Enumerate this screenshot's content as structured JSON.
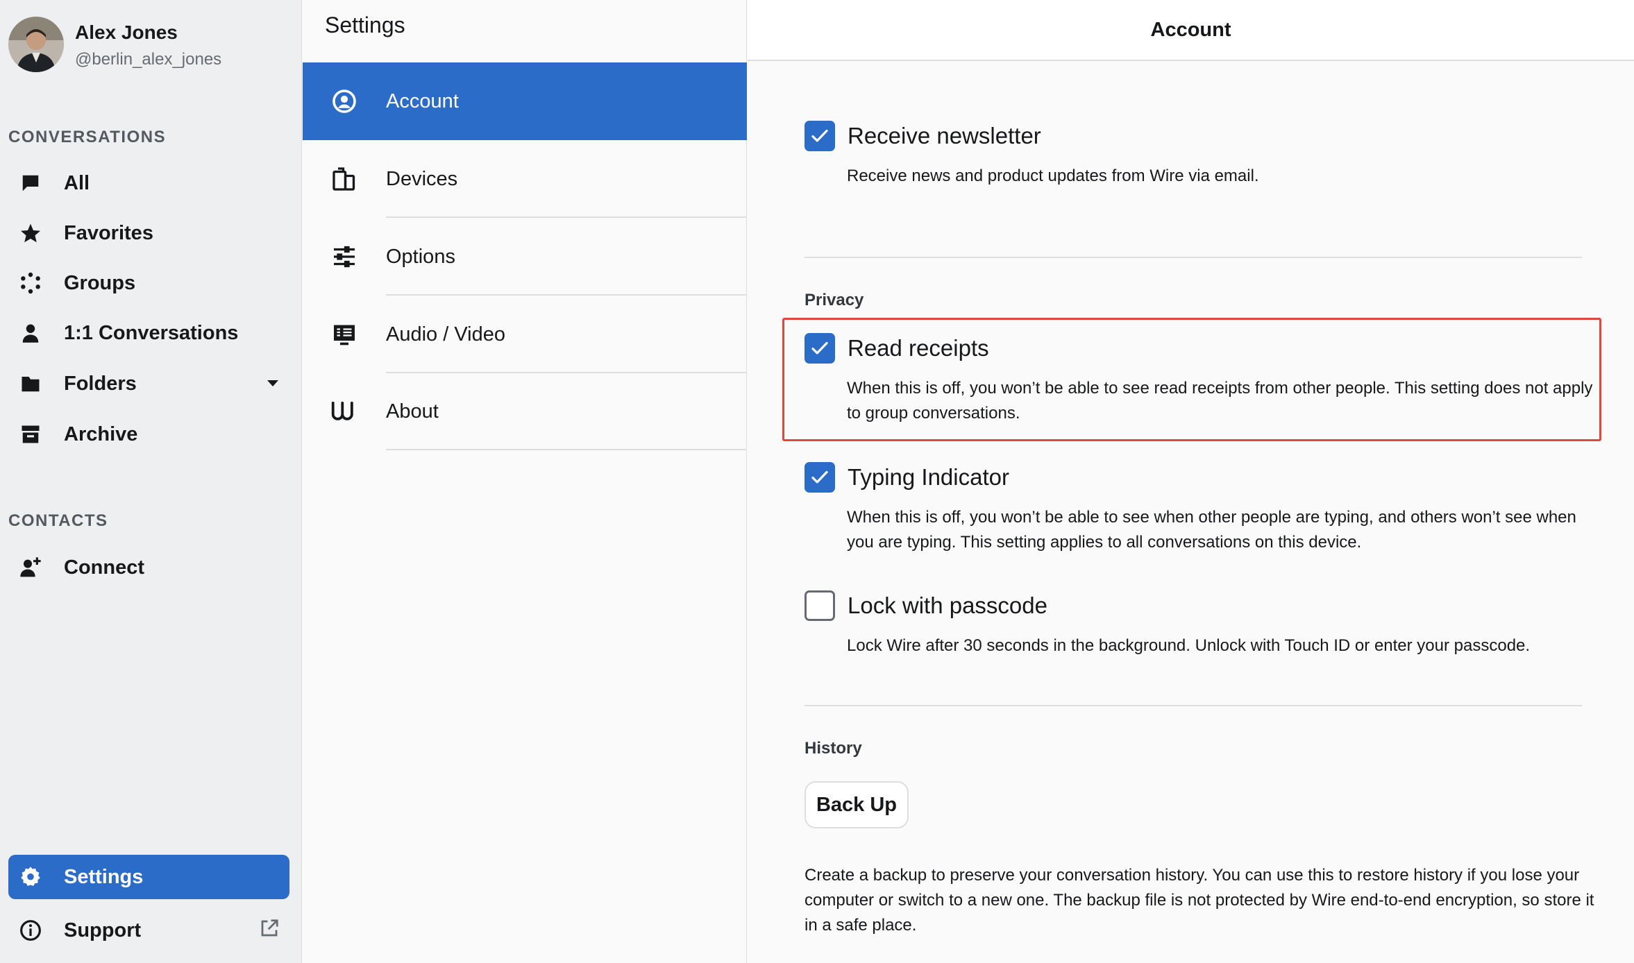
{
  "profile": {
    "name": "Alex Jones",
    "handle": "@berlin_alex_jones"
  },
  "sidebar": {
    "conversations_label": "CONVERSATIONS",
    "items": [
      {
        "label": "All",
        "icon": "chat-bubble-icon"
      },
      {
        "label": "Favorites",
        "icon": "star-icon"
      },
      {
        "label": "Groups",
        "icon": "groups-icon"
      },
      {
        "label": "1:1 Conversations",
        "icon": "person-icon"
      },
      {
        "label": "Folders",
        "icon": "folder-icon"
      },
      {
        "label": "Archive",
        "icon": "archive-icon"
      }
    ],
    "contacts_label": "CONTACTS",
    "connect_label": "Connect",
    "settings_label": "Settings",
    "support_label": "Support"
  },
  "settings": {
    "title": "Settings",
    "items": [
      {
        "label": "Account",
        "icon": "account-circle-icon",
        "active": true
      },
      {
        "label": "Devices",
        "icon": "devices-icon",
        "active": false
      },
      {
        "label": "Options",
        "icon": "sliders-icon",
        "active": false
      },
      {
        "label": "Audio / Video",
        "icon": "audio-video-icon",
        "active": false
      },
      {
        "label": "About",
        "icon": "wire-logo-icon",
        "active": false
      }
    ]
  },
  "main": {
    "header_title": "Account",
    "newsletter": {
      "title": "Receive newsletter",
      "desc": "Receive news and product updates from Wire via email.",
      "checked": true
    },
    "privacy_label": "Privacy",
    "read_receipts": {
      "title": "Read receipts",
      "desc": "When this is off, you won’t be able to see read receipts from other people. This setting does not apply to group conversations.",
      "checked": true
    },
    "typing_indicator": {
      "title": "Typing Indicator",
      "desc": "When this is off, you won’t be able to see when other people are typing, and others won’t see when you are typing. This setting applies to all conversations on this device.",
      "checked": true
    },
    "lock_passcode": {
      "title": "Lock with passcode",
      "desc": "Lock Wire after 30 seconds in the background. Unlock with Touch ID or enter your passcode.",
      "checked": false
    },
    "history_label": "History",
    "backup_button": "Back Up",
    "backup_desc": "Create a backup to preserve your conversation history. You can use this to restore history if you lose your computer or switch to a new one. The backup file is not protected by Wire end-to-end encryption, so store it in a safe place."
  },
  "colors": {
    "accent": "#2a6cc7",
    "highlight": "#e0463c",
    "sidebar_bg": "#edeff0"
  }
}
